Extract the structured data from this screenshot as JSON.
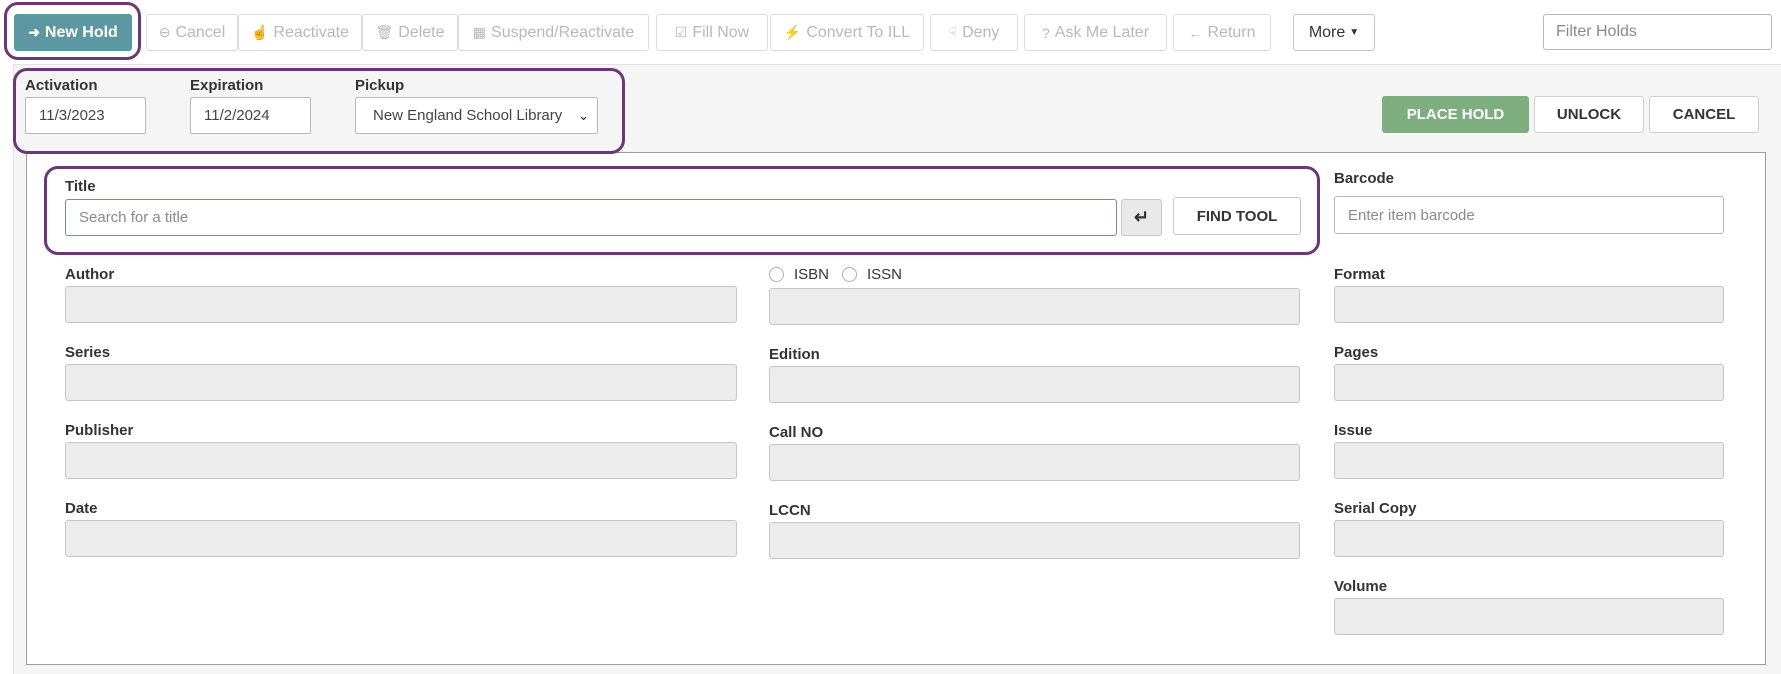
{
  "toolbar": {
    "new_hold": "New Hold",
    "cancel": "Cancel",
    "reactivate": "Reactivate",
    "delete": "Delete",
    "suspend_reactivate": "Suspend/Reactivate",
    "fill_now": "Fill Now",
    "convert_to_ill": "Convert To ILL",
    "deny": "Deny",
    "ask_me_later": "Ask Me Later",
    "return": "Return",
    "more": "More",
    "filter_placeholder": "Filter Holds"
  },
  "hold_settings": {
    "activation_label": "Activation",
    "activation_value": "11/3/2023",
    "expiration_label": "Expiration",
    "expiration_value": "11/2/2024",
    "pickup_label": "Pickup",
    "pickup_value": "New England School Library"
  },
  "actions": {
    "place_hold": "PLACE HOLD",
    "unlock": "UNLOCK",
    "cancel": "CANCEL"
  },
  "form": {
    "title_label": "Title",
    "title_placeholder": "Search for a title",
    "find_tool": "FIND TOOL",
    "barcode_label": "Barcode",
    "barcode_placeholder": "Enter item barcode",
    "author_label": "Author",
    "isbn_label": "ISBN",
    "issn_label": "ISSN",
    "format_label": "Format",
    "series_label": "Series",
    "edition_label": "Edition",
    "pages_label": "Pages",
    "publisher_label": "Publisher",
    "call_no_label": "Call NO",
    "issue_label": "Issue",
    "date_label": "Date",
    "lccn_label": "LCCN",
    "serial_copy_label": "Serial Copy",
    "volume_label": "Volume"
  },
  "icons": {
    "new_hold": "sign-in-icon",
    "cancel": "minus-circle-icon",
    "reactivate": "thumbs-up-icon",
    "delete": "trash-icon",
    "suspend_reactivate": "calendar-icon",
    "fill_now": "check-square-icon",
    "convert_to_ill": "bolt-icon",
    "deny": "thumbs-down-icon",
    "ask_me_later": "question-circle-icon",
    "return": "arrow-left-icon",
    "enter": "enter-icon"
  },
  "colors": {
    "primary": "#5d97a1",
    "place_hold": "#7eae80",
    "highlight": "#6b3779"
  }
}
